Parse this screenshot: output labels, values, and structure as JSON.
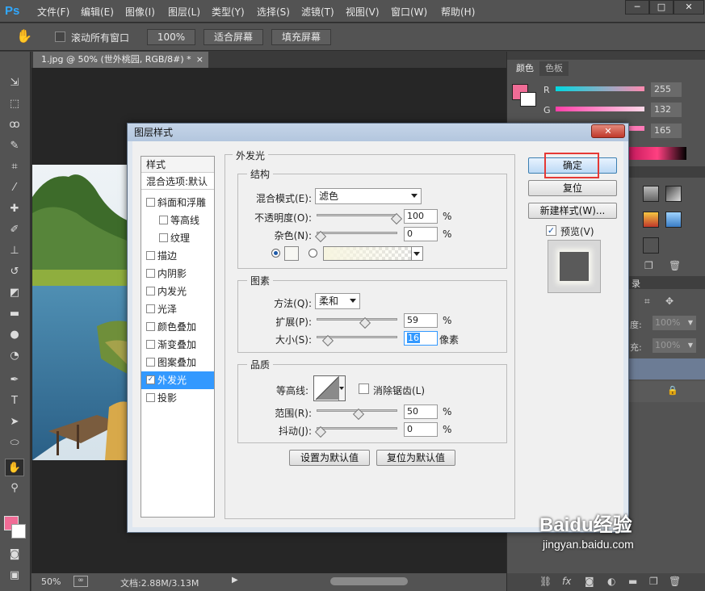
{
  "app": {
    "logo": "Ps",
    "menu": [
      "文件(F)",
      "编辑(E)",
      "图像(I)",
      "图层(L)",
      "类型(Y)",
      "选择(S)",
      "滤镜(T)",
      "视图(V)",
      "窗口(W)",
      "帮助(H)"
    ],
    "window_controls": [
      "─",
      "□",
      "✕"
    ]
  },
  "options_bar": {
    "scroll_all_label": "滚动所有窗口",
    "zoom_100": "100%",
    "fit_screen": "适合屏幕",
    "fill_screen": "填充屏幕"
  },
  "document": {
    "tab_title": "1.jpg @ 50% (世外桃园, RGB/8#) *",
    "tab_close": "×"
  },
  "status_bar": {
    "zoom": "50%",
    "doc_info": "文档:2.88M/3.13M"
  },
  "right_panel": {
    "tabs": [
      "颜色",
      "色板"
    ],
    "r_label": "R",
    "g_label": "G",
    "r_value": "255",
    "g_value": "132",
    "b_value": "165",
    "layers_tab": "录",
    "opacity_label": "度:",
    "opacity_value": "100%",
    "fill_label": "充:",
    "fill_value": "100%"
  },
  "dialog": {
    "title": "图层样式",
    "close": "✕",
    "styles_header": "样式",
    "blend_options": "混合选项:默认",
    "style_items": [
      {
        "label": "斜面和浮雕",
        "checked": false,
        "indent": false
      },
      {
        "label": "等高线",
        "checked": false,
        "indent": true
      },
      {
        "label": "纹理",
        "checked": false,
        "indent": true
      },
      {
        "label": "描边",
        "checked": false,
        "indent": false
      },
      {
        "label": "内阴影",
        "checked": false,
        "indent": false
      },
      {
        "label": "内发光",
        "checked": false,
        "indent": false
      },
      {
        "label": "光泽",
        "checked": false,
        "indent": false
      },
      {
        "label": "颜色叠加",
        "checked": false,
        "indent": false
      },
      {
        "label": "渐变叠加",
        "checked": false,
        "indent": false
      },
      {
        "label": "图案叠加",
        "checked": false,
        "indent": false
      },
      {
        "label": "外发光",
        "checked": true,
        "indent": false
      },
      {
        "label": "投影",
        "checked": false,
        "indent": false
      }
    ],
    "section_title": "外发光",
    "structure": {
      "title": "结构",
      "blend_mode_label": "混合模式(E):",
      "blend_mode_value": "滤色",
      "opacity_label": "不透明度(O):",
      "opacity_value": "100",
      "opacity_level": 100,
      "noise_label": "杂色(N):",
      "noise_value": "0",
      "noise_level": 0,
      "pct": "%"
    },
    "elements": {
      "title": "图素",
      "method_label": "方法(Q):",
      "method_value": "柔和",
      "spread_label": "扩展(P):",
      "spread_value": "59",
      "spread_level": 59,
      "size_label": "大小(S):",
      "size_value": "16",
      "size_level": 10,
      "size_unit": "像素",
      "pct": "%"
    },
    "quality": {
      "title": "品质",
      "contour_label": "等高线:",
      "antialias_label": "消除锯齿(L)",
      "range_label": "范围(R):",
      "range_value": "50",
      "range_level": 50,
      "jitter_label": "抖动(J):",
      "jitter_value": "0",
      "jitter_level": 0,
      "pct": "%"
    },
    "make_default": "设置为默认值",
    "reset_default": "复位为默认值",
    "ok": "确定",
    "reset": "复位",
    "new_style": "新建样式(W)...",
    "preview_label": "预览(V)"
  },
  "watermark": {
    "brand": "Baidu经验",
    "url": "jingyan.baidu.com"
  },
  "colors": {
    "foreground": "#f06c96",
    "accent": "#3399ff",
    "highlight": "#e53935"
  }
}
